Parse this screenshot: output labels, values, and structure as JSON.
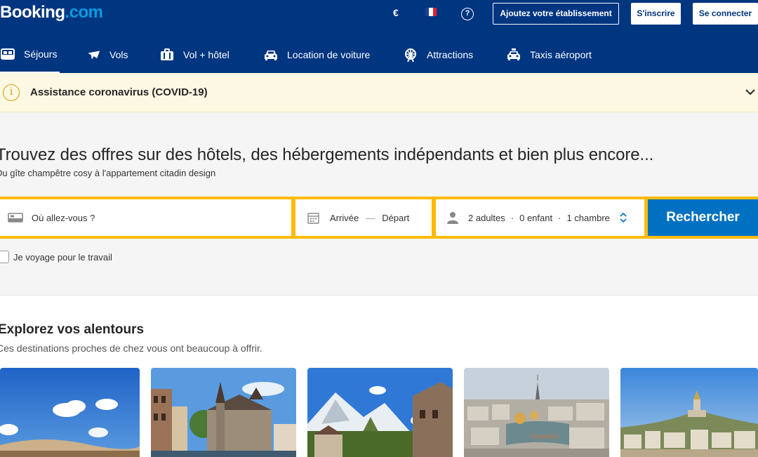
{
  "header": {
    "logo_part1": "Booking",
    "logo_part2": ".com",
    "currency": "€",
    "list_property": "Ajoutez votre établissement",
    "signup": "S'inscrire",
    "login": "Se connecter"
  },
  "nav": {
    "items": [
      {
        "label": "Séjours",
        "icon": "bed-icon"
      },
      {
        "label": "Vols",
        "icon": "plane-icon"
      },
      {
        "label": "Vol + hôtel",
        "icon": "suitcase-icon"
      },
      {
        "label": "Location de voiture",
        "icon": "car-icon"
      },
      {
        "label": "Attractions",
        "icon": "ferris-wheel-icon"
      },
      {
        "label": "Taxis aéroport",
        "icon": "taxi-icon"
      }
    ]
  },
  "covid": {
    "text": "Assistance coronavirus (COVID-19)"
  },
  "hero": {
    "title": "Trouvez des offres sur des hôtels, des hébergements indépendants et bien plus encore...",
    "subtitle": "Du gîte champêtre cosy à l'appartement citadin design"
  },
  "search": {
    "destination_placeholder": "Où allez-vous ?",
    "checkin": "Arrivée",
    "dash": "—",
    "checkout": "Départ",
    "adults": "2 adultes",
    "children": "0 enfant",
    "rooms": "1 chambre",
    "sep": "·",
    "button": "Rechercher",
    "work_travel": "Je voyage pour le travail"
  },
  "explore": {
    "title": "Explorez vos alentours",
    "subtitle": "Ces destinations proches de chez vous ont beaucoup à offrir."
  },
  "colors": {
    "brand_dark": "#003580",
    "brand_light": "#009fe3",
    "search_border": "#febb02",
    "cta": "#0071c2",
    "covid_bg": "#fcf8e3"
  }
}
